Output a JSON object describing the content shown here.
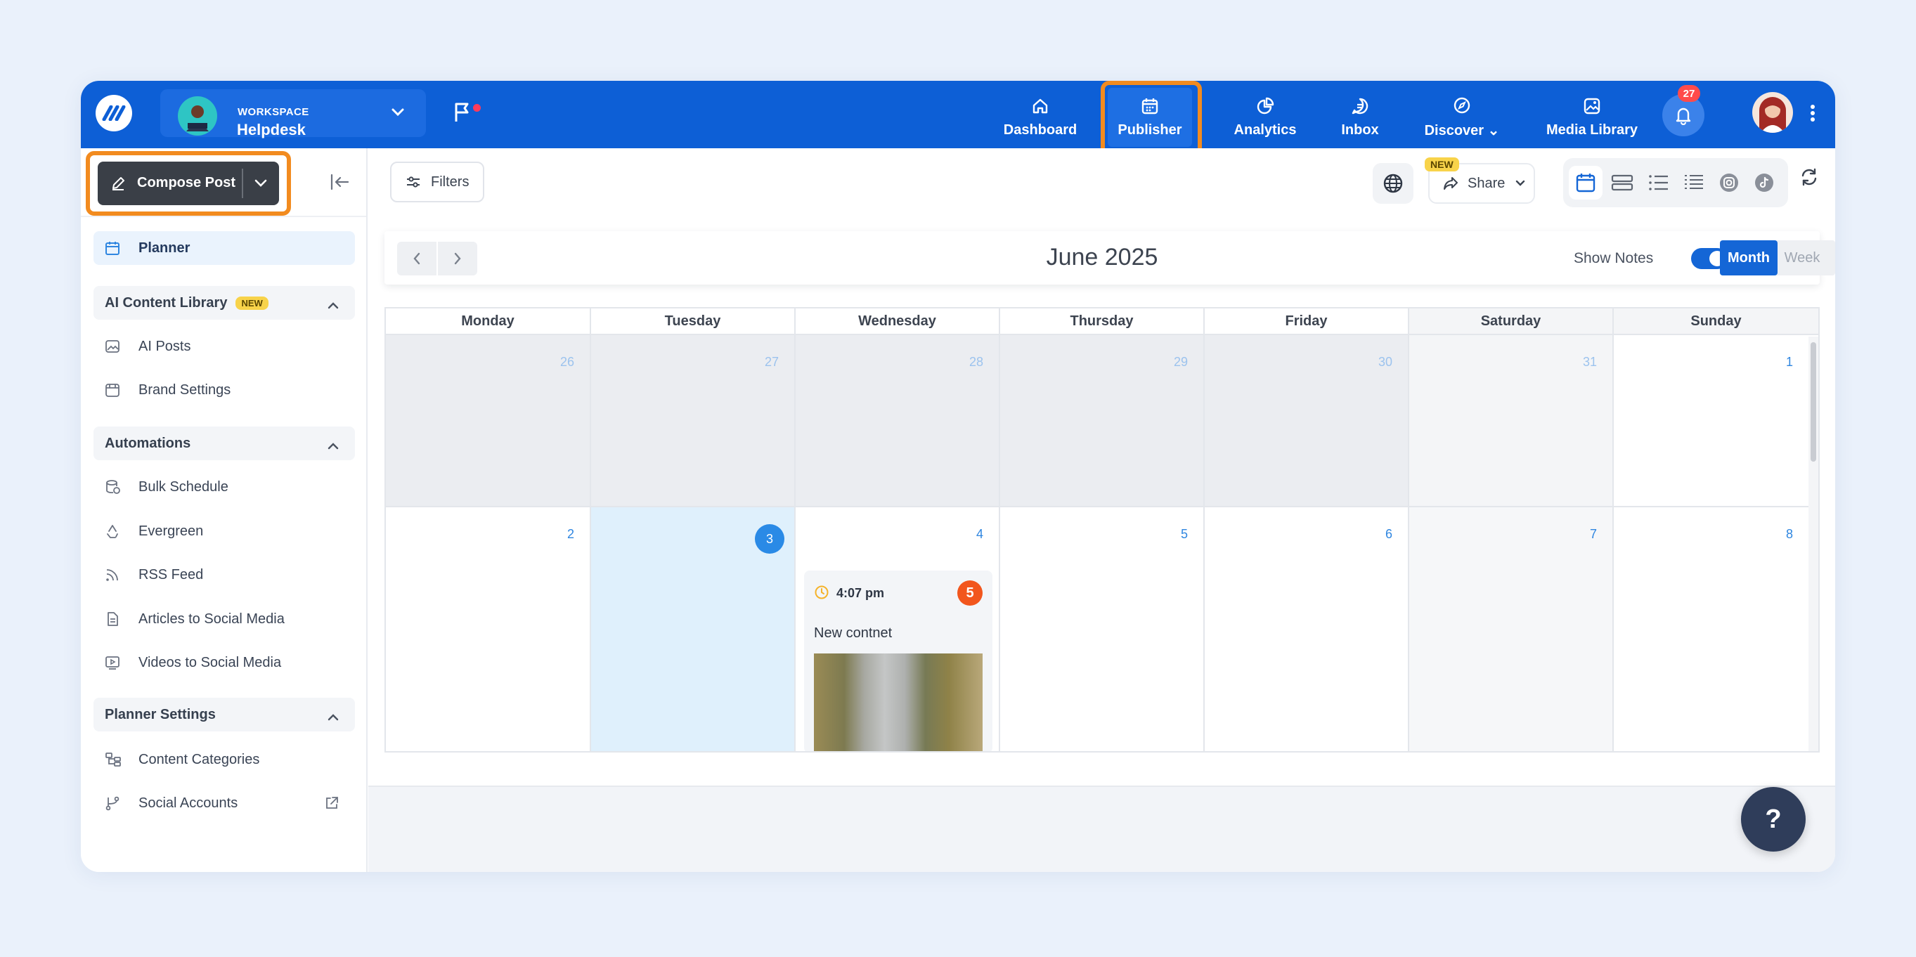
{
  "workspace": {
    "label": "WORKSPACE",
    "name": "Helpdesk"
  },
  "nav": [
    {
      "label": "Dashboard",
      "icon": "home-icon"
    },
    {
      "label": "Publisher",
      "icon": "calendar-icon",
      "active": true
    },
    {
      "label": "Analytics",
      "icon": "pie-chart-icon"
    },
    {
      "label": "Inbox",
      "icon": "chat-icon"
    },
    {
      "label": "Discover",
      "icon": "compass-icon"
    },
    {
      "label": "Media Library",
      "icon": "image-icon"
    }
  ],
  "notifications": {
    "count": "27"
  },
  "compose": {
    "label": "Compose Post"
  },
  "sidebar": {
    "planner": "Planner",
    "ai_section": {
      "title": "AI Content Library",
      "badge": "NEW",
      "items": [
        "AI Posts",
        "Brand Settings"
      ]
    },
    "automations": {
      "title": "Automations",
      "items": [
        "Bulk Schedule",
        "Evergreen",
        "RSS Feed",
        "Articles to Social Media",
        "Videos to Social Media"
      ]
    },
    "planner_settings": {
      "title": "Planner Settings",
      "items": [
        "Content Categories",
        "Social Accounts"
      ]
    }
  },
  "toolbar": {
    "filters": "Filters",
    "share": "Share",
    "share_badge": "NEW"
  },
  "calendar": {
    "title": "June 2025",
    "show_notes": "Show Notes",
    "show_notes_on": true,
    "view_month": "Month",
    "view_week": "Week",
    "weekdays": [
      "Monday",
      "Tuesday",
      "Wednesday",
      "Thursday",
      "Friday",
      "Saturday",
      "Sunday"
    ],
    "week1": [
      "26",
      "27",
      "28",
      "29",
      "30",
      "31",
      "1"
    ],
    "week2": [
      "2",
      "3",
      "4",
      "5",
      "6",
      "7",
      "8"
    ],
    "today": "3"
  },
  "post": {
    "time": "4:07 pm",
    "text": "New contnet",
    "account_initial": "5"
  },
  "help": {
    "label": "?"
  },
  "colors": {
    "brand": "#0d5fd6",
    "highlight": "#f28b1f",
    "today": "#2a8ae6"
  }
}
